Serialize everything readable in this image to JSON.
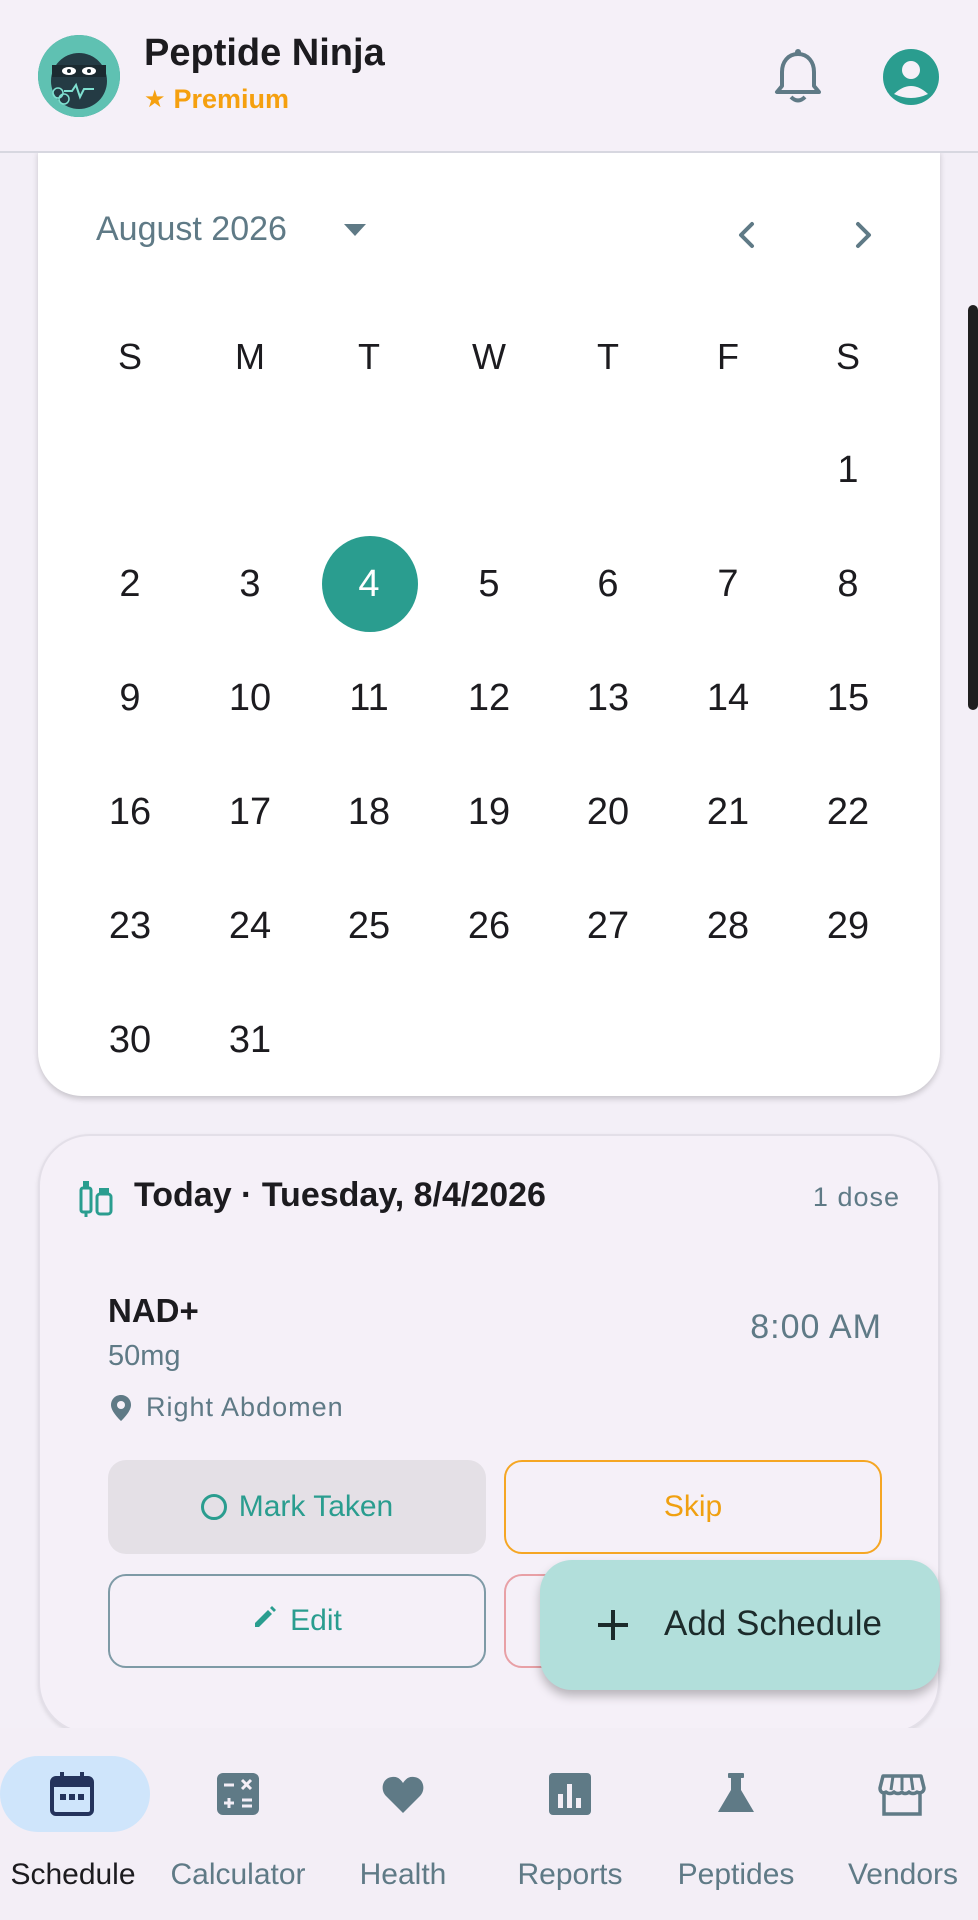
{
  "header": {
    "app_name": "Peptide Ninja",
    "tier": "Premium"
  },
  "calendar": {
    "month_label": "August 2026",
    "weekdays": [
      "S",
      "M",
      "T",
      "W",
      "T",
      "F",
      "S"
    ],
    "selected_day": "4",
    "weeks": [
      [
        "",
        "",
        "",
        "",
        "",
        "",
        "1"
      ],
      [
        "2",
        "3",
        "4",
        "5",
        "6",
        "7",
        "8"
      ],
      [
        "9",
        "10",
        "11",
        "12",
        "13",
        "14",
        "15"
      ],
      [
        "16",
        "17",
        "18",
        "19",
        "20",
        "21",
        "22"
      ],
      [
        "23",
        "24",
        "25",
        "26",
        "27",
        "28",
        "29"
      ],
      [
        "30",
        "31",
        "",
        "",
        "",
        "",
        ""
      ]
    ]
  },
  "today": {
    "title": "Today · Tuesday, 8/4/2026",
    "dose_count": "1 dose",
    "dose": {
      "name": "NAD+",
      "amount": "50mg",
      "site": "Right Abdomen",
      "time": "8:00 AM"
    },
    "actions": {
      "mark_taken": "Mark Taken",
      "skip": "Skip",
      "edit": "Edit"
    }
  },
  "fab": {
    "label": "Add Schedule"
  },
  "bottom_nav": [
    {
      "label": "Schedule",
      "icon": "calendar-icon",
      "active": true
    },
    {
      "label": "Calculator",
      "icon": "calculator-icon",
      "active": false
    },
    {
      "label": "Health",
      "icon": "heart-icon",
      "active": false
    },
    {
      "label": "Reports",
      "icon": "bar-chart-icon",
      "active": false
    },
    {
      "label": "Peptides",
      "icon": "flask-icon",
      "active": false
    },
    {
      "label": "Vendors",
      "icon": "store-icon",
      "active": false
    }
  ],
  "colors": {
    "accent": "#2a9d8f",
    "premium": "#f5a00f",
    "muted_text": "#5f7a86",
    "fab_bg": "#b2dfdb",
    "nav_active_pill": "#cfe5fb"
  }
}
